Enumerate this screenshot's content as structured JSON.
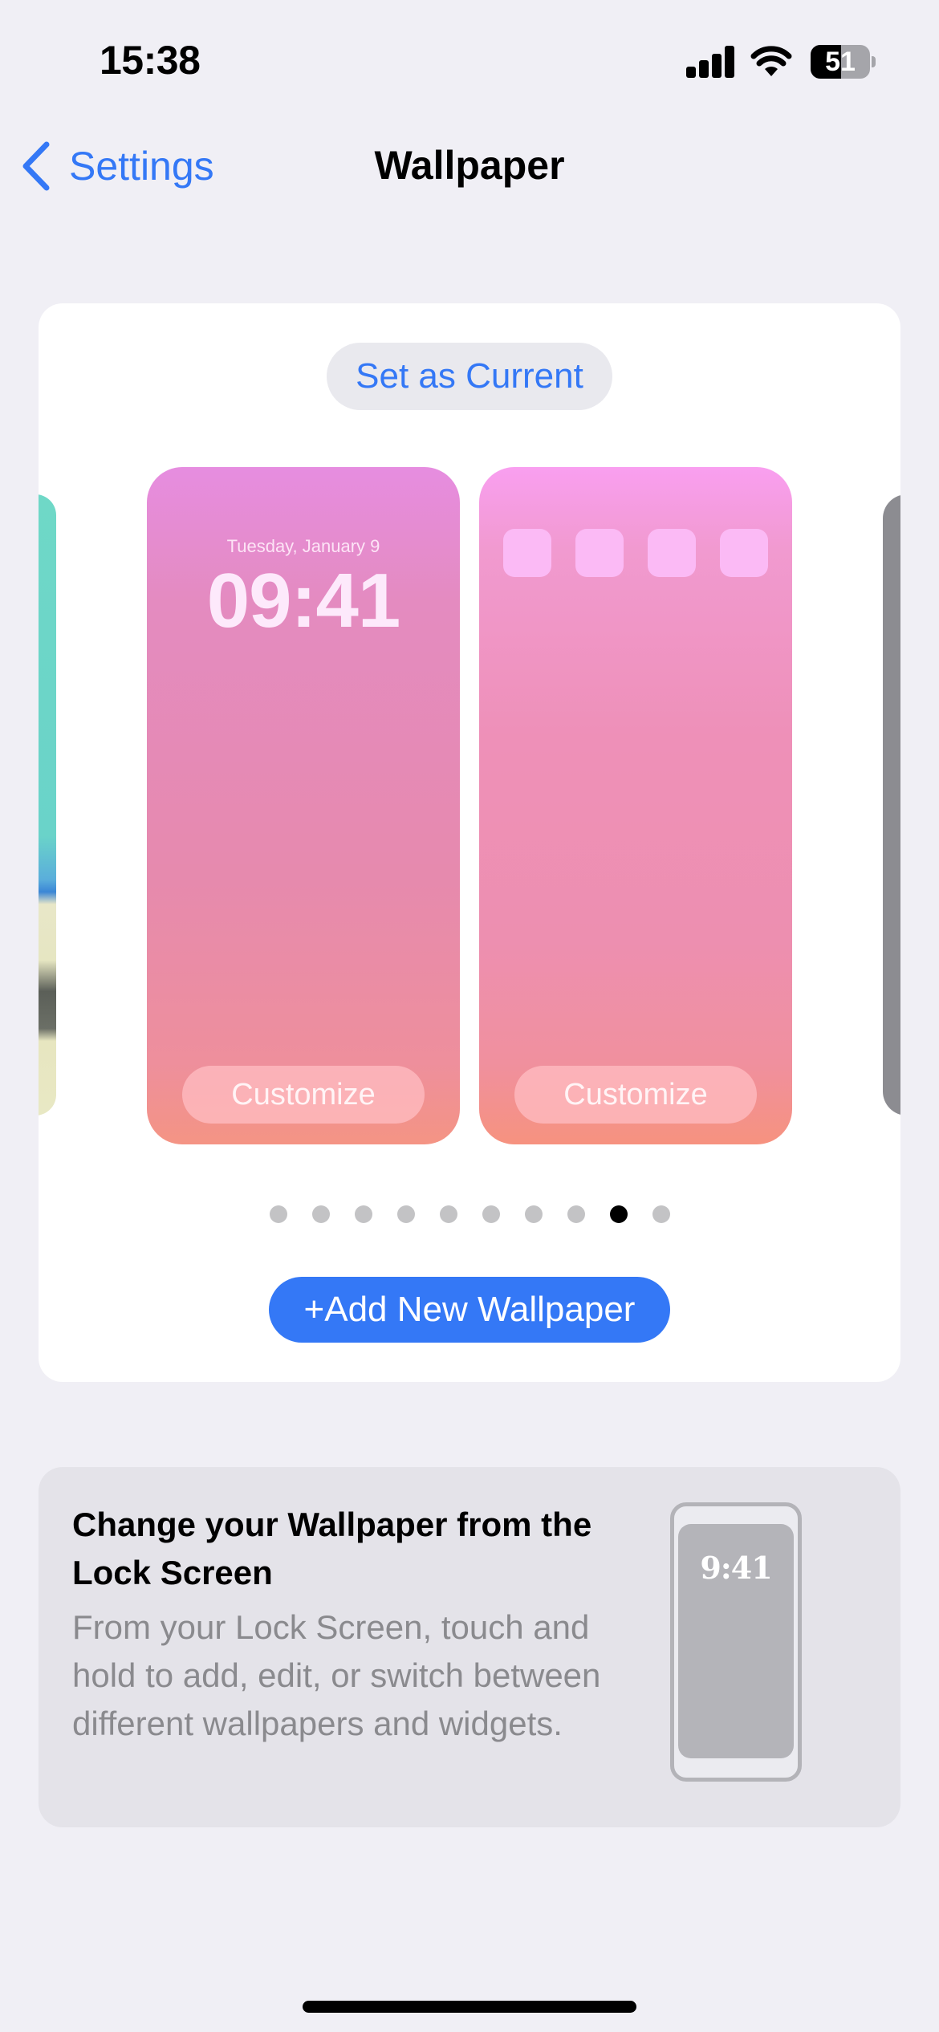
{
  "status_bar": {
    "time": "15:38",
    "battery_level": "51",
    "battery_fraction": 0.51,
    "signal_bars": 4,
    "icons": [
      "cellular-signal-icon",
      "wifi-icon",
      "battery-icon"
    ]
  },
  "nav": {
    "back_label": "Settings",
    "back_icon": "chevron-left-icon",
    "title": "Wallpaper"
  },
  "wallpaper_card": {
    "set_current_label": "Set as Current",
    "lock_screen_preview": {
      "date": "Tuesday, January 9",
      "time": "09:41",
      "customize_label": "Customize"
    },
    "home_screen_preview": {
      "app_icon_count": 4,
      "customize_label": "Customize"
    },
    "page_indicator": {
      "total": 10,
      "active_index": 8
    },
    "add_button_label": "+Add New Wallpaper"
  },
  "info_card": {
    "title": "Change your Wallpaper from the Lock Screen",
    "body": "From your Lock Screen, touch and hold to add, edit, or switch between different wallpapers and widgets.",
    "illustration_time": "9:41"
  },
  "colors": {
    "accent": "#3478f6",
    "background": "#f0eff5",
    "secondary_text": "#8a8a8e"
  }
}
